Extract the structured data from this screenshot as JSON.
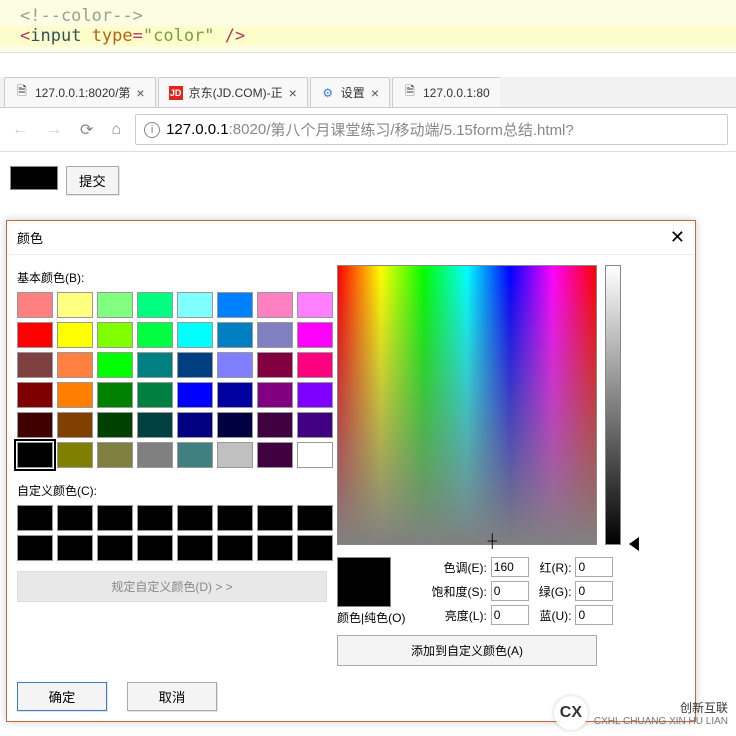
{
  "code": {
    "comment": "<!--color-->",
    "line2_lt": "<",
    "line2_tag": "input",
    "line2_attr": "type",
    "line2_eq": "=",
    "line2_str": "\"color\"",
    "line2_end": " />"
  },
  "tabs": [
    {
      "label": "127.0.0.1:8020/第",
      "close": "×"
    },
    {
      "label": "京东(JD.COM)-正",
      "close": "×"
    },
    {
      "label": "设置",
      "close": "×"
    },
    {
      "label": "127.0.0.1:80"
    }
  ],
  "url": {
    "host": "127.0.0.1",
    "port": ":8020",
    "path": "/第八个月课堂练习/移动端/5.15form总结.html?"
  },
  "page": {
    "submit": "提交"
  },
  "dialog": {
    "title": "颜色",
    "basic_label": "基本颜色(B):",
    "custom_label": "自定义颜色(C):",
    "define": "规定自定义颜色(D) > >",
    "preview_label": "颜色|纯色(O)",
    "hue": "色调(E):",
    "hue_v": "160",
    "sat": "饱和度(S):",
    "sat_v": "0",
    "lum": "亮度(L):",
    "lum_v": "0",
    "red": "红(R):",
    "red_v": "0",
    "green": "绿(G):",
    "green_v": "0",
    "blue": "蓝(U):",
    "blue_v": "0",
    "add": "添加到自定义颜色(A)",
    "ok": "确定",
    "cancel": "取消"
  },
  "swatches": [
    "#ff8080",
    "#ffff80",
    "#80ff80",
    "#00ff80",
    "#80ffff",
    "#0080ff",
    "#ff80c0",
    "#ff80ff",
    "#ff0000",
    "#ffff00",
    "#80ff00",
    "#00ff40",
    "#00ffff",
    "#0080c0",
    "#8080c0",
    "#ff00ff",
    "#804040",
    "#ff8040",
    "#00ff00",
    "#008080",
    "#004080",
    "#8080ff",
    "#800040",
    "#ff0080",
    "#800000",
    "#ff8000",
    "#008000",
    "#008040",
    "#0000ff",
    "#0000a0",
    "#800080",
    "#8000ff",
    "#400000",
    "#804000",
    "#004000",
    "#004040",
    "#000080",
    "#000040",
    "#400040",
    "#400080",
    "#000000",
    "#808000",
    "#808040",
    "#808080",
    "#408080",
    "#c0c0c0",
    "#400040",
    "#ffffff"
  ],
  "watermark": {
    "brand": "创新互联",
    "sub": "CXHL CHUANG XIN HU LIAN"
  }
}
